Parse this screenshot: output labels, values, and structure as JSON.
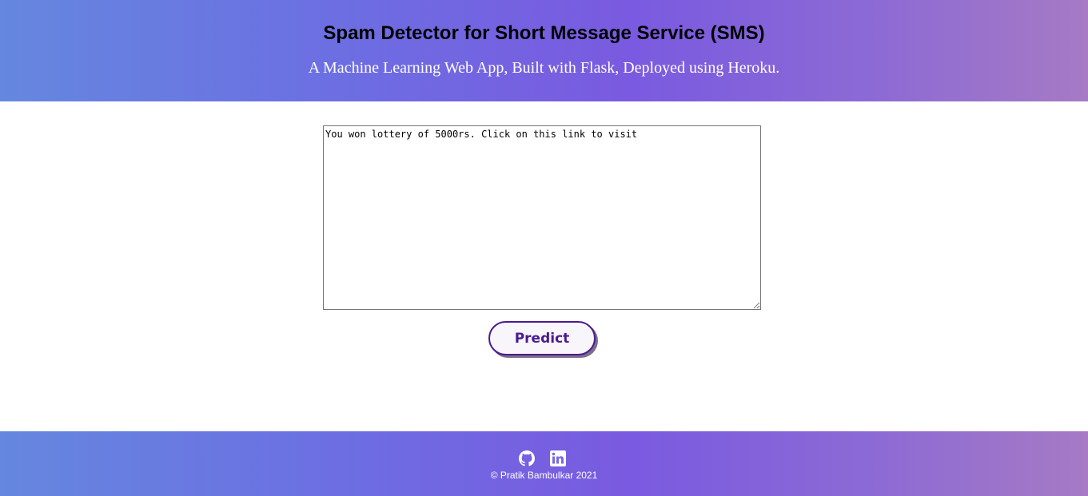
{
  "header": {
    "title": "Spam Detector for Short Message Service (SMS)",
    "subtitle": "A Machine Learning Web App, Built with Flask, Deployed using Heroku."
  },
  "form": {
    "message_value": "You won lottery of 5000rs. Click on this link to visit",
    "predict_label": "Predict"
  },
  "footer": {
    "icons": [
      "github-icon",
      "linkedin-icon"
    ],
    "copyright": "© Pratik Bambulkar 2021"
  },
  "colors": {
    "gradient_start": "#6587df",
    "gradient_mid": "#7a5ae0",
    "gradient_end": "#a67ac4",
    "button_accent": "#4b1a8f"
  }
}
